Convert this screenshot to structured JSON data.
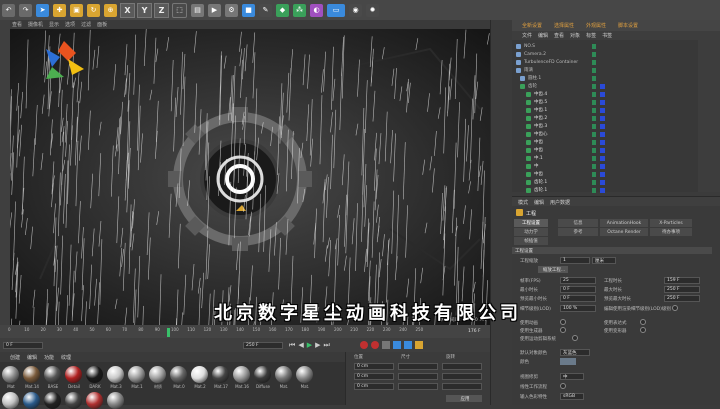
{
  "toolbar": {
    "icons": [
      "undo-icon",
      "redo-icon",
      "live-select-icon",
      "move-icon",
      "scale-icon",
      "rotate-icon",
      "recent-icon",
      "x-axis",
      "y-axis",
      "z-axis",
      "coord-system-icon",
      "render-region-icon",
      "render-view-icon",
      "render-settings-icon",
      "cube-icon",
      "pen-icon",
      "subdivision-icon",
      "cloner-icon",
      "deformer-icon",
      "scene-icon",
      "camera-icon",
      "light-icon"
    ],
    "axis_x": "X",
    "axis_y": "Y",
    "axis_z": "Z"
  },
  "viewport_menu": [
    "查看",
    "摄像机",
    "显示",
    "选项",
    "过滤",
    "面板"
  ],
  "viewport": {
    "hud_left": "",
    "hud_right": "网格间距：10000 cm"
  },
  "timeline": {
    "ticks": [
      "0",
      "10",
      "20",
      "30",
      "40",
      "50",
      "60",
      "70",
      "80",
      "90",
      "100",
      "110",
      "120",
      "130",
      "140",
      "150",
      "160",
      "170",
      "180",
      "190",
      "200",
      "210",
      "220",
      "230",
      "240",
      "250"
    ],
    "current_frame": "170",
    "frame_start": "0 F",
    "frame_field": "0 F",
    "frame_end": "250 F",
    "frame_end2": "250 F",
    "current": "176 F"
  },
  "material_menu": [
    "创建",
    "编辑",
    "功能",
    "纹理"
  ],
  "materials": [
    {
      "label": "Mat",
      "color": "#8a8a8a"
    },
    {
      "label": "Mat.14",
      "color": "#7a5a3a"
    },
    {
      "label": "BASE",
      "color": "#555"
    },
    {
      "label": "Detail",
      "color": "#b02020"
    },
    {
      "label": "DARK",
      "color": "#1a1a1a"
    },
    {
      "label": "Mat.3",
      "color": "#c8c8c8"
    },
    {
      "label": "Mat.1",
      "color": "#9a9a9a"
    },
    {
      "label": "材质",
      "color": "#a0a0a0"
    },
    {
      "label": "Mat.0",
      "color": "#666"
    },
    {
      "label": "Mat.2",
      "color": "#ddd"
    },
    {
      "label": "Mat.17",
      "color": "#444"
    },
    {
      "label": "Mat.16",
      "color": "#999"
    },
    {
      "label": "Diffuse",
      "color": "#3a3a3a"
    },
    {
      "label": "Mat.",
      "color": "#777"
    },
    {
      "label": "Mat.",
      "color": "#888"
    }
  ],
  "materials_row2": [
    {
      "color": "#c0c0c0"
    },
    {
      "color": "#2a5a8a"
    },
    {
      "color": "#222"
    },
    {
      "color": "#444"
    },
    {
      "color": "#b03030"
    },
    {
      "color": "#888"
    }
  ],
  "coords": {
    "headers": [
      "位置",
      "尺寸",
      "旋转"
    ],
    "x": "0 cm",
    "y": "0 cm",
    "z": "0 cm",
    "apply": "应用"
  },
  "layout": {
    "label1": "全新设置",
    "label2": "选择属性",
    "label3": "外观属性",
    "label4": "脚本设置"
  },
  "obj_menu": [
    "文件",
    "编辑",
    "查看",
    "对象",
    "标签",
    "书签"
  ],
  "objects": [
    {
      "name": "NO.S",
      "indent": 4,
      "color": "#bbb",
      "icon": "null-icon"
    },
    {
      "name": "Camera.2",
      "indent": 4,
      "color": "#bbb",
      "icon": "camera-icon"
    },
    {
      "name": "TurbulenceFD Container",
      "indent": 4,
      "color": "#bbb",
      "icon": "container-icon"
    },
    {
      "name": "雨滴",
      "indent": 4,
      "color": "#bbb",
      "icon": "group-icon"
    },
    {
      "name": "圆柱.1",
      "indent": 8,
      "color": "#bbb",
      "icon": "cylinder-icon"
    },
    {
      "name": "齿轮",
      "indent": 8,
      "color": "#bbb",
      "icon": "gear-icon"
    },
    {
      "name": "中齿.4",
      "indent": 14,
      "color": "#ddd",
      "icon": "gear-icon"
    },
    {
      "name": "中齿.5",
      "indent": 14,
      "color": "#ddd",
      "icon": "gear-icon"
    },
    {
      "name": "中齿.1",
      "indent": 14,
      "color": "#ddd",
      "icon": "gear-icon"
    },
    {
      "name": "中齿.2",
      "indent": 14,
      "color": "#ddd",
      "icon": "gear-icon"
    },
    {
      "name": "中齿.3",
      "indent": 14,
      "color": "#ddd",
      "icon": "gear-icon"
    },
    {
      "name": "中齿心",
      "indent": 14,
      "color": "#ddd",
      "icon": "gear-icon"
    },
    {
      "name": "中齿",
      "indent": 14,
      "color": "#ddd",
      "icon": "gear-icon"
    },
    {
      "name": "中齿",
      "indent": 14,
      "color": "#ddd",
      "icon": "gear-icon"
    },
    {
      "name": "中.1",
      "indent": 14,
      "color": "#ddd",
      "icon": "gear-icon"
    },
    {
      "name": "中",
      "indent": 14,
      "color": "#ddd",
      "icon": "gear-icon"
    },
    {
      "name": "中齿",
      "indent": 14,
      "color": "#ddd",
      "icon": "gear-icon"
    },
    {
      "name": "齿轮.1",
      "indent": 14,
      "color": "#ddd",
      "icon": "gear-icon"
    },
    {
      "name": "齿轮.1",
      "indent": 14,
      "color": "#ddd",
      "icon": "gear-icon"
    }
  ],
  "attr_menu": [
    "模式",
    "编辑",
    "用户数据"
  ],
  "attr": {
    "title": "工程",
    "tabs": [
      "工程设置",
      "信息",
      "AnimationHook",
      "X-Particles",
      "动力学",
      "参考",
      "Octane Render",
      "待办事项",
      "帧插值"
    ],
    "section": "工程设置",
    "scale_label": "工程缩放",
    "scale_value": "1",
    "scale_unit": "厘米",
    "scale_btn": "缩放工程...",
    "fps_label": "帧率(FPS)",
    "fps_value": "25",
    "min_label": "最小时长",
    "min_value": "0 F",
    "preview_min_label": "预览最小时长",
    "preview_min_value": "0 F",
    "project_time_label": "工程时长",
    "project_time_value": "159 F",
    "max_label": "最大时长",
    "max_value": "250 F",
    "preview_max_label": "预览最大时长",
    "preview_max_value": "250 F",
    "lod_label": "细节级别(LOD)",
    "lod_value": "100 %",
    "lod_render": "编辑使用渲染细节级别(LOD)级别",
    "use_anim": "使用动画",
    "use_expr": "使用表达式",
    "use_gen": "使用生成器",
    "use_deform": "使用变形器",
    "use_motion": "使用运动剪辑系统",
    "default_color_label": "默认对象颜色",
    "default_color_value": "灰蓝色",
    "color_label": "颜色",
    "view_clip": "视图修剪",
    "view_clip_value": "中",
    "linear": "线性工作流程",
    "input_color": "输入色彩特性",
    "input_color_value": "sRGB"
  },
  "watermark": "北京数字星尘动画科技有限公司"
}
